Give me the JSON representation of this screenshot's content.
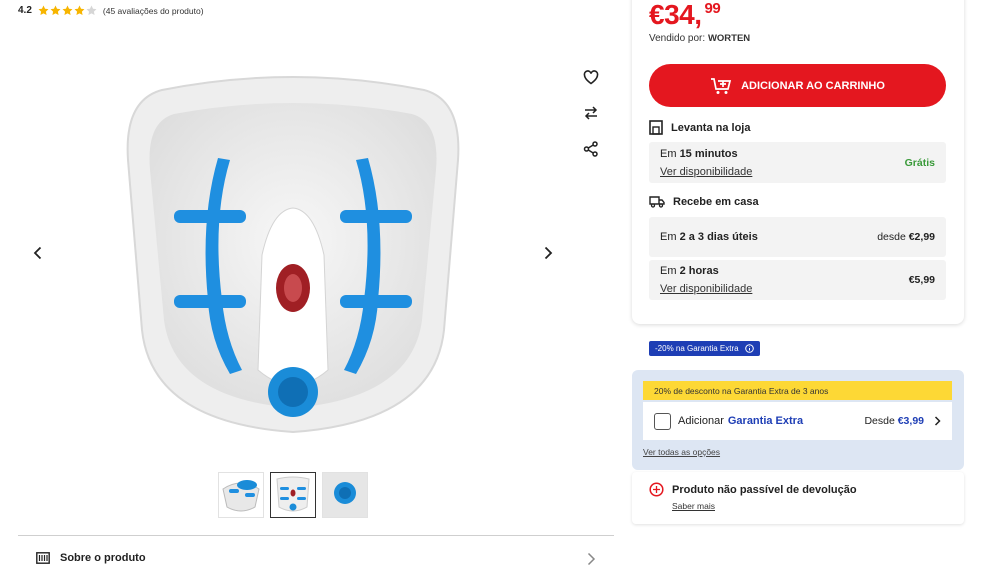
{
  "rating": {
    "score": "4.2",
    "stars_filled": 4.2,
    "stars_total": 5,
    "count_label": "(45 avaliações do produto)"
  },
  "gallery": {
    "icons": [
      "heart-icon",
      "compare-arrows-icon",
      "share-icon",
      "chevron-left-icon",
      "chevron-right-icon"
    ],
    "thumbnails_count": 3,
    "active_thumbnail": 2
  },
  "about": {
    "label": "Sobre o produto"
  },
  "price": {
    "whole": "€34,",
    "cents": "99"
  },
  "seller": {
    "prefix": "Vendido por:",
    "name": "WORTEN"
  },
  "cart": {
    "label": "ADICIONAR AO CARRINHO"
  },
  "pickup": {
    "title": "Levanta na loja",
    "time_prefix": "Em",
    "time_value": "15 minutos",
    "availability_link": "Ver disponibilidade",
    "price": "Grátis"
  },
  "delivery": {
    "title": "Recebe em casa",
    "option1": {
      "prefix": "Em",
      "value": "2 a 3 dias úteis",
      "price_prefix": "desde",
      "price": "€2,99"
    },
    "option2": {
      "prefix": "Em",
      "value": "2 horas",
      "availability_link": "Ver disponibilidade",
      "price": "€5,99"
    }
  },
  "warranty": {
    "tag": "-20% na Garantia Extra",
    "banner": "20% de desconto na Garantia Extra de 3 anos",
    "add_prefix": "Adicionar",
    "add_name": "Garantia Extra",
    "price_prefix": "Desde",
    "price": "€3,99",
    "options_link": "Ver todas as opções"
  },
  "returns": {
    "title": "Produto não passível de devolução",
    "more_link": "Saber mais"
  },
  "colors": {
    "accent_red": "#e4171f",
    "brand_blue": "#1e3eb5",
    "banner_yellow": "#fdd835",
    "free_green": "#3a9a3a"
  }
}
